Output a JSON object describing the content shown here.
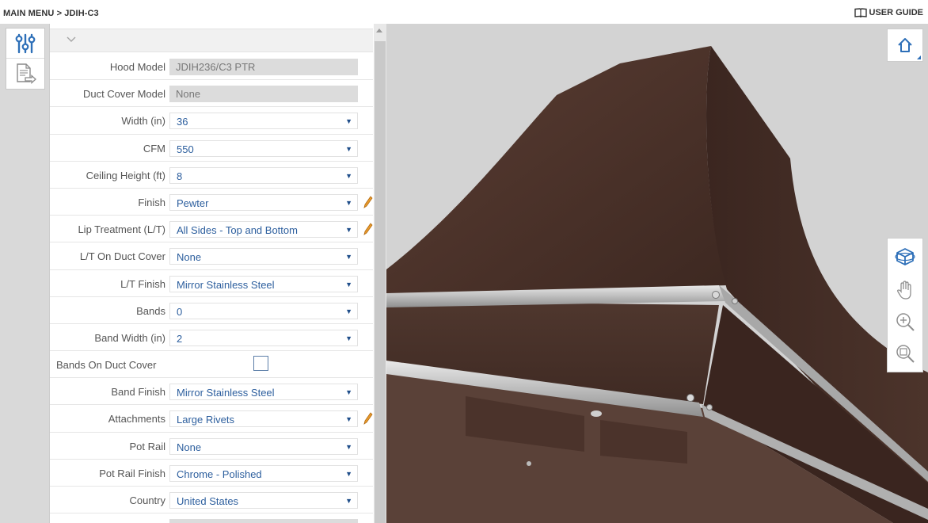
{
  "breadcrumb": "MAIN MENU > JDIH-C3",
  "user_guide": "USER GUIDE",
  "form": {
    "rows": [
      {
        "label": "Hood Model",
        "value": "JDIH236/C3 PTR",
        "kind": "readonly"
      },
      {
        "label": "Duct Cover Model",
        "value": "None",
        "kind": "readonly"
      },
      {
        "label": "Width (in)",
        "value": "36",
        "kind": "select"
      },
      {
        "label": "CFM",
        "value": "550",
        "kind": "select"
      },
      {
        "label": "Ceiling Height (ft)",
        "value": "8",
        "kind": "select"
      },
      {
        "label": "Finish",
        "value": "Pewter",
        "kind": "select",
        "edit": true
      },
      {
        "label": "Lip Treatment (L/T)",
        "value": "All Sides - Top and Bottom",
        "kind": "select",
        "edit": true
      },
      {
        "label": "L/T On Duct Cover",
        "value": "None",
        "kind": "select"
      },
      {
        "label": "L/T Finish",
        "value": "Mirror Stainless Steel",
        "kind": "select"
      },
      {
        "label": "Bands",
        "value": "0",
        "kind": "select"
      },
      {
        "label": "Band Width (in)",
        "value": "2",
        "kind": "select"
      },
      {
        "label": "Bands On Duct Cover",
        "value": "",
        "kind": "checkbox",
        "checked": false
      },
      {
        "label": "Band Finish",
        "value": "Mirror Stainless Steel",
        "kind": "select"
      },
      {
        "label": "Attachments",
        "value": "Large Rivets",
        "kind": "select",
        "edit": true
      },
      {
        "label": "Pot Rail",
        "value": "None",
        "kind": "select"
      },
      {
        "label": "Pot Rail Finish",
        "value": "Chrome - Polished",
        "kind": "select"
      },
      {
        "label": "Country",
        "value": "United States",
        "kind": "select"
      }
    ]
  },
  "icons": {
    "settings": "sliders-icon",
    "export": "document-export-icon",
    "home": "home-icon",
    "view_cube": "view-cube-icon",
    "pan": "hand-pan-icon",
    "zoom_in": "zoom-in-icon",
    "zoom_fit": "zoom-fit-icon"
  },
  "colors": {
    "accent": "#2d6fb8",
    "value_text": "#2d5f9e",
    "hood_dark": "#4a3129",
    "viewport_bg": "#d3d3d3"
  }
}
